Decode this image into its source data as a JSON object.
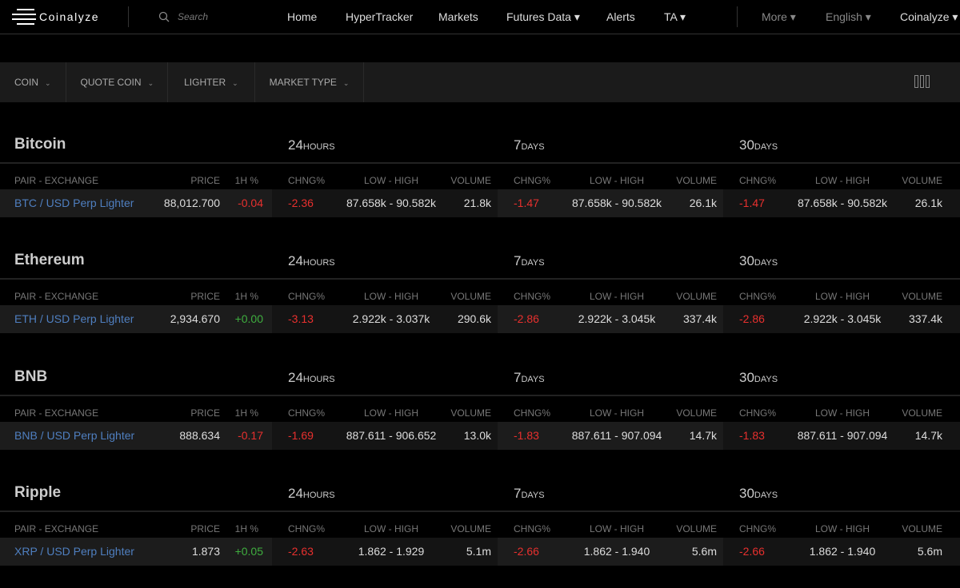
{
  "header": {
    "logo": "Coinalyze",
    "search_placeholder": "Search",
    "nav": [
      "Home",
      "HyperTracker",
      "Markets",
      "Futures Data ▾",
      "Alerts",
      "TA ▾"
    ],
    "right": [
      "More ▾",
      "English ▾",
      "Coinalyze ▾"
    ]
  },
  "filters": [
    "COIN",
    "QUOTE COIN",
    "LIGHTER",
    "MARKET TYPE"
  ],
  "periods": [
    {
      "n": "24",
      "u": "HOURS"
    },
    {
      "n": "7",
      "u": "DAYS"
    },
    {
      "n": "30",
      "u": "DAYS"
    }
  ],
  "columns": {
    "pair": "PAIR - EXCHANGE",
    "price": "PRICE",
    "h1": "1H %",
    "chng": "CHNG%",
    "lowhigh": "LOW - HIGH",
    "volume": "VOLUME"
  },
  "colors": {
    "negative": "#e8302e",
    "positive": "#3fae3f",
    "link": "#4f7fc0"
  },
  "sections": [
    {
      "title": "Bitcoin",
      "pair": "BTC / USD Perp Lighter",
      "price": "88,012.700",
      "h1": "-0.04",
      "p": [
        {
          "chng": "-2.36",
          "lh": "87.658k - 90.582k",
          "vol": "21.8k"
        },
        {
          "chng": "-1.47",
          "lh": "87.658k - 90.582k",
          "vol": "26.1k"
        },
        {
          "chng": "-1.47",
          "lh": "87.658k - 90.582k",
          "vol": "26.1k"
        }
      ]
    },
    {
      "title": "Ethereum",
      "pair": "ETH / USD Perp Lighter",
      "price": "2,934.670",
      "h1": "+0.00",
      "p": [
        {
          "chng": "-3.13",
          "lh": "2.922k - 3.037k",
          "vol": "290.6k"
        },
        {
          "chng": "-2.86",
          "lh": "2.922k - 3.045k",
          "vol": "337.4k"
        },
        {
          "chng": "-2.86",
          "lh": "2.922k - 3.045k",
          "vol": "337.4k"
        }
      ]
    },
    {
      "title": "BNB",
      "pair": "BNB / USD Perp Lighter",
      "price": "888.634",
      "h1": "-0.17",
      "p": [
        {
          "chng": "-1.69",
          "lh": "887.611 - 906.652",
          "vol": "13.0k"
        },
        {
          "chng": "-1.83",
          "lh": "887.611 - 907.094",
          "vol": "14.7k"
        },
        {
          "chng": "-1.83",
          "lh": "887.611 - 907.094",
          "vol": "14.7k"
        }
      ]
    },
    {
      "title": "Ripple",
      "pair": "XRP / USD Perp Lighter",
      "price": "1.873",
      "h1": "+0.05",
      "p": [
        {
          "chng": "-2.63",
          "lh": "1.862 - 1.929",
          "vol": "5.1m"
        },
        {
          "chng": "-2.66",
          "lh": "1.862 - 1.940",
          "vol": "5.6m"
        },
        {
          "chng": "-2.66",
          "lh": "1.862 - 1.940",
          "vol": "5.6m"
        }
      ]
    }
  ]
}
